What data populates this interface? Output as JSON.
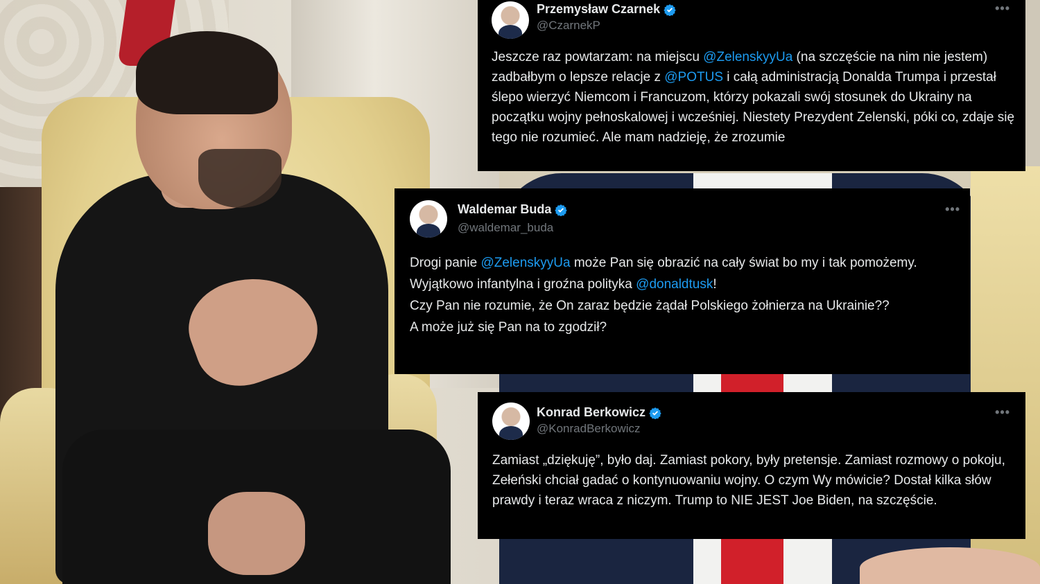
{
  "tweets": [
    {
      "name": "Przemysław Czarnek",
      "handle": "@CzarnekP",
      "more": "•••",
      "verified": true,
      "body": [
        {
          "t": "Jeszcze raz powtarzam: na miejscu "
        },
        {
          "t": "@ZelenskyyUa",
          "m": true
        },
        {
          "t": " (na szczęście na nim nie jestem) zadbałbym o lepsze relacje z "
        },
        {
          "t": "@POTUS",
          "m": true
        },
        {
          "t": " i całą administracją Donalda Trumpa i przestał ślepo wierzyć Niemcom i Francuzom, którzy pokazali swój stosunek do Ukrainy na początku wojny pełnoskalowej i wcześniej. Niestety Prezydent Zelenski, póki co, zdaje się tego nie rozumieć. Ale mam nadzieję, że zrozumie"
        }
      ]
    },
    {
      "name": "Waldemar Buda",
      "handle": "@waldemar_buda",
      "more": "•••",
      "verified": true,
      "body": [
        {
          "t": "Drogi panie "
        },
        {
          "t": "@ZelenskyyUa",
          "m": true
        },
        {
          "t": " może Pan się obrazić na cały świat bo my i tak pomożemy."
        },
        {
          "br": true
        },
        {
          "t": "Wyjątkowo infantylna i groźna polityka "
        },
        {
          "t": "@donaldtusk",
          "m": true
        },
        {
          "t": "!"
        },
        {
          "br": true
        },
        {
          "t": "Czy Pan nie rozumie, że On zaraz będzie żądał Polskiego żołnierza na Ukrainie??"
        },
        {
          "br": true
        },
        {
          "t": "A może już się Pan na to zgodził?"
        }
      ]
    },
    {
      "name": "Konrad Berkowicz",
      "handle": "@KonradBerkowicz",
      "more": "•••",
      "verified": true,
      "body": [
        {
          "t": "Zamiast „dziękuję”, było daj. Zamiast pokory, były pretensje. Zamiast rozmowy o pokoju, Zełeński chciał gadać o kontynuowaniu wojny. O czym Wy mówicie? Dostał kilka słów prawdy i teraz wraca z niczym. Trump to NIE JEST Joe Biden, na szczęście."
        }
      ]
    }
  ],
  "colors": {
    "tweet_bg": "#000000",
    "text": "#e7e9ea",
    "muted": "#71767b",
    "mention": "#1d9bf0",
    "verified": "#1d9bf0"
  }
}
